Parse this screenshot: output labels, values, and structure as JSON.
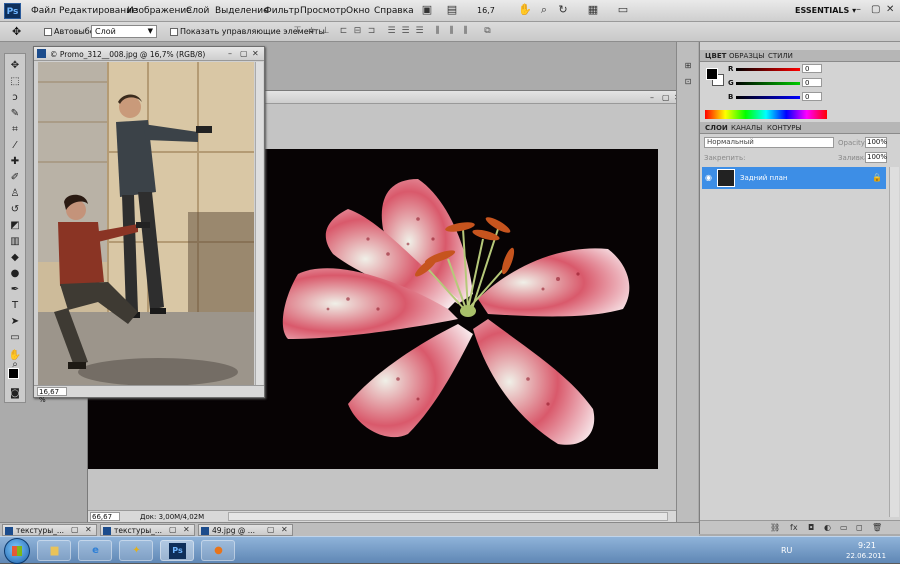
{
  "menubar": {
    "logo": "Ps",
    "items": [
      "Файл",
      "Редактирование",
      "Изображение",
      "Слой",
      "Выделение",
      "Фильтр",
      "Просмотр",
      "Окно",
      "Справка"
    ],
    "zoom": "16,7",
    "workspace": "ESSENTIALS",
    "workspace_arrow": "▾",
    "window_controls": [
      "–",
      "▢",
      "✕"
    ]
  },
  "options_bar": {
    "autoselect_label": "Автовыбор:",
    "autoselect_value": "Слой",
    "show_controls_label": "Показать управляющие элементы"
  },
  "document": {
    "zoom": "66,67 %",
    "doc_size": "Док: 3,00M/4,02M",
    "controls": [
      "–",
      "▢",
      "✕"
    ]
  },
  "promo_window": {
    "title": "© Promo_312__008.jpg @ 16,7% (RGB/8)",
    "zoom": "16,67 %",
    "controls": [
      "–",
      "▢",
      "✕"
    ]
  },
  "color_panel": {
    "tabs": [
      "ЦВЕТ",
      "ОБРАЗЦЫ",
      "СТИЛИ"
    ],
    "r_label": "R",
    "r_value": "0",
    "g_label": "G",
    "g_value": "0",
    "b_label": "B",
    "b_value": "0"
  },
  "layers_panel": {
    "tabs": [
      "СЛОИ",
      "КАНАЛЫ",
      "КОНТУРЫ"
    ],
    "blend_mode": "Нормальный",
    "opacity_label": "Opacity:",
    "opacity_value": "100%",
    "lock_label": "Закрепить:",
    "fill_label": "Заливка:",
    "fill_value": "100%",
    "layer_name": "Задний план"
  },
  "doc_tabs": [
    {
      "label": "текстуры_..."
    },
    {
      "label": "текстуры_..."
    },
    {
      "label": "49.jpg @ ..."
    }
  ],
  "taskbar": {
    "lang": "RU",
    "time": "9:21",
    "date": "22.06.2011"
  },
  "colors": {
    "accent": "#3d8ee6",
    "panel": "#cfcfcf",
    "workspace": "#ababab"
  }
}
